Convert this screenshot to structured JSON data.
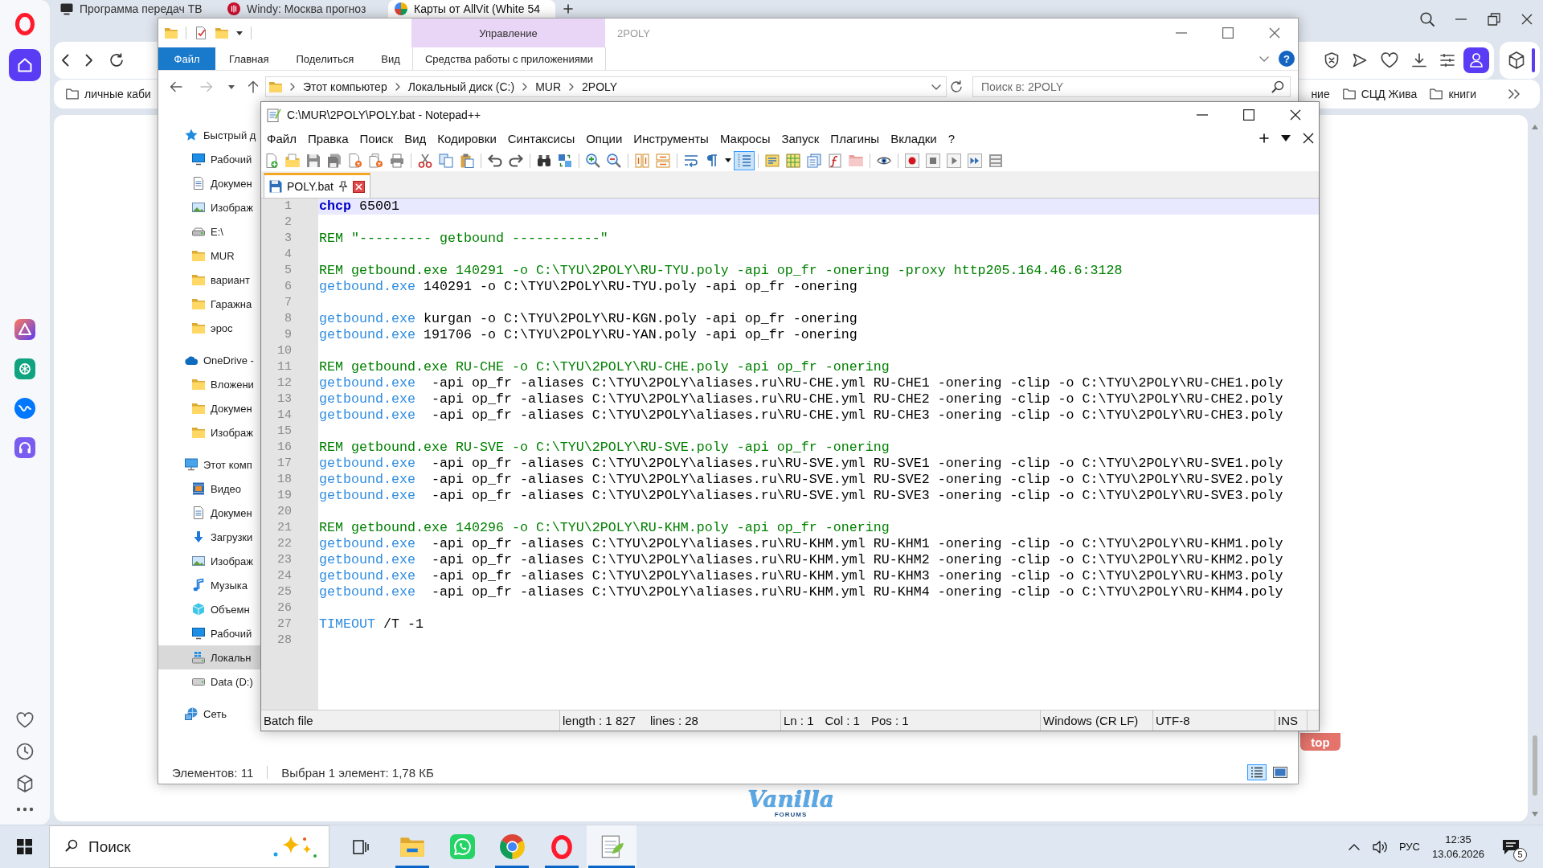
{
  "browser": {
    "tabs": [
      {
        "title": "Программа передач ТВ",
        "kind": "tv",
        "selected": false
      },
      {
        "title": "Windy: Москва прогноз",
        "kind": "weather",
        "selected": false
      },
      {
        "title": "Карты от AllVit (White 54",
        "kind": "maps",
        "selected": true
      }
    ],
    "bookmarks_left": [
      {
        "title": "личные каби",
        "kind": "folder"
      }
    ],
    "bookmarks_right": [
      {
        "title": "ние",
        "kind": "text"
      },
      {
        "title": "СЦД Жива",
        "kind": "folder"
      },
      {
        "title": "книги",
        "kind": "folder"
      }
    ],
    "page": {
      "scroll_top_label": "top",
      "logo": {
        "title": "Vanilla",
        "subtitle": "FORUMS"
      }
    }
  },
  "explorer": {
    "context_group": "Управление",
    "title": "2POLY",
    "ribbon_tabs": [
      {
        "label": "Файл",
        "kind": "file"
      },
      {
        "label": "Главная",
        "kind": "tab"
      },
      {
        "label": "Поделиться",
        "kind": "tab"
      },
      {
        "label": "Вид",
        "kind": "tab"
      },
      {
        "label": "Средства работы с приложениями",
        "kind": "context"
      }
    ],
    "help_label": "?",
    "breadcrumb": [
      "Этот компьютер",
      "Локальный диск (C:)",
      "MUR",
      "2POLY"
    ],
    "search": {
      "placeholder": "Поиск в: 2POLY"
    },
    "navigation": [
      {
        "label": "Быстрый д",
        "kind": "quick-access",
        "selected": false,
        "children": [
          {
            "label": "Рабочий",
            "kind": "desktop",
            "selected": false
          },
          {
            "label": "Докумен",
            "kind": "documents",
            "selected": false
          },
          {
            "label": "Изображ",
            "kind": "pictures",
            "selected": false
          },
          {
            "label": "E:\\",
            "kind": "removable-drive",
            "selected": false
          },
          {
            "label": "MUR",
            "kind": "folder",
            "selected": false
          },
          {
            "label": "вариант",
            "kind": "folder",
            "selected": false
          },
          {
            "label": "Гаражна",
            "kind": "folder",
            "selected": false
          },
          {
            "label": "эрос",
            "kind": "folder",
            "selected": false
          }
        ]
      },
      {
        "label": "OneDrive -",
        "kind": "cloud",
        "selected": false,
        "children": [
          {
            "label": "Вложени",
            "kind": "folder",
            "selected": false
          },
          {
            "label": "Докумен",
            "kind": "folder",
            "selected": false
          },
          {
            "label": "Изображ",
            "kind": "folder",
            "selected": false
          }
        ]
      },
      {
        "label": "Этот комп",
        "kind": "computer",
        "selected": false,
        "children": [
          {
            "label": "Видео",
            "kind": "video",
            "selected": false
          },
          {
            "label": "Докумен",
            "kind": "documents",
            "selected": false
          },
          {
            "label": "Загрузки",
            "kind": "downloads",
            "selected": false
          },
          {
            "label": "Изображ",
            "kind": "pictures",
            "selected": false
          },
          {
            "label": "Музыка",
            "kind": "music",
            "selected": false
          },
          {
            "label": "Объемн",
            "kind": "objects",
            "selected": false
          },
          {
            "label": "Рабочий",
            "kind": "desktop",
            "selected": false
          },
          {
            "label": "Локальн",
            "kind": "local-disk",
            "selected": true
          },
          {
            "label": "Data (D:)",
            "kind": "drive",
            "selected": false
          }
        ]
      },
      {
        "label": "Сеть",
        "kind": "network",
        "selected": false
      }
    ],
    "status": {
      "item_count": "Элементов: 11",
      "selection": "Выбран 1 элемент: 1,78 КБ"
    },
    "views": [
      {
        "kind": "details",
        "selected": true
      },
      {
        "kind": "large-icons",
        "selected": false
      }
    ]
  },
  "notepad": {
    "title": "C:\\MUR\\2POLY\\POLY.bat - Notepad++",
    "menu": [
      "Файл",
      "Правка",
      "Поиск",
      "Вид",
      "Кодировки",
      "Синтаксисы",
      "Опции",
      "Инструменты",
      "Макросы",
      "Запуск",
      "Плагины",
      "Вкладки",
      "?"
    ],
    "view_toggles": [
      {
        "kind": "word-wrap",
        "on": false
      },
      {
        "kind": "show-symbols",
        "on": false
      },
      {
        "kind": "indent-guide",
        "on": true
      }
    ],
    "tabs": [
      {
        "label": "POLY.bat",
        "selected": true
      }
    ],
    "lines": [
      {
        "number": "1",
        "current": true,
        "tokens": [
          {
            "text": "chcp",
            "kind": "keyword"
          },
          {
            "text": " 65001",
            "kind": "plain"
          }
        ]
      },
      {
        "number": "2",
        "current": false
      },
      {
        "number": "3",
        "current": false,
        "tokens": [
          {
            "text": "REM \"--------- getbound -----------\"",
            "kind": "comment"
          }
        ]
      },
      {
        "number": "4",
        "current": false
      },
      {
        "number": "5",
        "current": false,
        "tokens": [
          {
            "text": "REM getbound.exe 140291 -o C:\\TYU\\2POLY\\RU-TYU.poly -api op_fr -onering -proxy http205.164.46.6:3128",
            "kind": "comment"
          }
        ]
      },
      {
        "number": "6",
        "current": false,
        "tokens": [
          {
            "text": "getbound.exe",
            "kind": "command"
          },
          {
            "text": " 140291 -o C:\\TYU\\2POLY\\RU-TYU.poly -api op_fr -onering",
            "kind": "plain"
          }
        ]
      },
      {
        "number": "7",
        "current": false
      },
      {
        "number": "8",
        "current": false,
        "tokens": [
          {
            "text": "getbound.exe",
            "kind": "command"
          },
          {
            "text": " kurgan -o C:\\TYU\\2POLY\\RU-KGN.poly -api op_fr -onering",
            "kind": "plain"
          }
        ]
      },
      {
        "number": "9",
        "current": false,
        "tokens": [
          {
            "text": "getbound.exe",
            "kind": "command"
          },
          {
            "text": " 191706 -o C:\\TYU\\2POLY\\RU-YAN.poly -api op_fr -onering",
            "kind": "plain"
          }
        ]
      },
      {
        "number": "10",
        "current": false
      },
      {
        "number": "11",
        "current": false,
        "tokens": [
          {
            "text": "REM getbound.exe RU-CHE -o C:\\TYU\\2POLY\\RU-CHE.poly -api op_fr -onering",
            "kind": "comment"
          }
        ]
      },
      {
        "number": "12",
        "current": false,
        "tokens": [
          {
            "text": "getbound.exe",
            "kind": "command"
          },
          {
            "text": "  -api op_fr -aliases C:\\TYU\\2POLY\\aliases.ru\\RU-CHE.yml RU-CHE1 -onering -clip -o C:\\TYU\\2POLY\\RU-CHE1.poly",
            "kind": "plain"
          }
        ]
      },
      {
        "number": "13",
        "current": false,
        "tokens": [
          {
            "text": "getbound.exe",
            "kind": "command"
          },
          {
            "text": "  -api op_fr -aliases C:\\TYU\\2POLY\\aliases.ru\\RU-CHE.yml RU-CHE2 -onering -clip -o C:\\TYU\\2POLY\\RU-CHE2.poly",
            "kind": "plain"
          }
        ]
      },
      {
        "number": "14",
        "current": false,
        "tokens": [
          {
            "text": "getbound.exe",
            "kind": "command"
          },
          {
            "text": "  -api op_fr -aliases C:\\TYU\\2POLY\\aliases.ru\\RU-CHE.yml RU-CHE3 -onering -clip -o C:\\TYU\\2POLY\\RU-CHE3.poly",
            "kind": "plain"
          }
        ]
      },
      {
        "number": "15",
        "current": false
      },
      {
        "number": "16",
        "current": false,
        "tokens": [
          {
            "text": "REM getbound.exe RU-SVE -o C:\\TYU\\2POLY\\RU-SVE.poly -api op_fr -onering",
            "kind": "comment"
          }
        ]
      },
      {
        "number": "17",
        "current": false,
        "tokens": [
          {
            "text": "getbound.exe",
            "kind": "command"
          },
          {
            "text": "  -api op_fr -aliases C:\\TYU\\2POLY\\aliases.ru\\RU-SVE.yml RU-SVE1 -onering -clip -o C:\\TYU\\2POLY\\RU-SVE1.poly",
            "kind": "plain"
          }
        ]
      },
      {
        "number": "18",
        "current": false,
        "tokens": [
          {
            "text": "getbound.exe",
            "kind": "command"
          },
          {
            "text": "  -api op_fr -aliases C:\\TYU\\2POLY\\aliases.ru\\RU-SVE.yml RU-SVE2 -onering -clip -o C:\\TYU\\2POLY\\RU-SVE2.poly",
            "kind": "plain"
          }
        ]
      },
      {
        "number": "19",
        "current": false,
        "tokens": [
          {
            "text": "getbound.exe",
            "kind": "command"
          },
          {
            "text": "  -api op_fr -aliases C:\\TYU\\2POLY\\aliases.ru\\RU-SVE.yml RU-SVE3 -onering -clip -o C:\\TYU\\2POLY\\RU-SVE3.poly",
            "kind": "plain"
          }
        ]
      },
      {
        "number": "20",
        "current": false
      },
      {
        "number": "21",
        "current": false,
        "tokens": [
          {
            "text": "REM getbound.exe 140296 -o C:\\TYU\\2POLY\\RU-KHM.poly -api op_fr -onering",
            "kind": "comment"
          }
        ]
      },
      {
        "number": "22",
        "current": false,
        "tokens": [
          {
            "text": "getbound.exe",
            "kind": "command"
          },
          {
            "text": "  -api op_fr -aliases C:\\TYU\\2POLY\\aliases.ru\\RU-KHM.yml RU-KHM1 -onering -clip -o C:\\TYU\\2POLY\\RU-KHM1.poly",
            "kind": "plain"
          }
        ]
      },
      {
        "number": "23",
        "current": false,
        "tokens": [
          {
            "text": "getbound.exe",
            "kind": "command"
          },
          {
            "text": "  -api op_fr -aliases C:\\TYU\\2POLY\\aliases.ru\\RU-KHM.yml RU-KHM2 -onering -clip -o C:\\TYU\\2POLY\\RU-KHM2.poly",
            "kind": "plain"
          }
        ]
      },
      {
        "number": "24",
        "current": false,
        "tokens": [
          {
            "text": "getbound.exe",
            "kind": "command"
          },
          {
            "text": "  -api op_fr -aliases C:\\TYU\\2POLY\\aliases.ru\\RU-KHM.yml RU-KHM3 -onering -clip -o C:\\TYU\\2POLY\\RU-KHM3.poly",
            "kind": "plain"
          }
        ]
      },
      {
        "number": "25",
        "current": false,
        "tokens": [
          {
            "text": "getbound.exe",
            "kind": "command"
          },
          {
            "text": "  -api op_fr -aliases C:\\TYU\\2POLY\\aliases.ru\\RU-KHM.yml RU-KHM4 -onering -clip -o C:\\TYU\\2POLY\\RU-KHM4.poly",
            "kind": "plain"
          }
        ]
      },
      {
        "number": "26",
        "current": false
      },
      {
        "number": "27",
        "current": false,
        "tokens": [
          {
            "text": "TIMEOUT",
            "kind": "command"
          },
          {
            "text": " /T -1",
            "kind": "plain"
          }
        ]
      },
      {
        "number": "28",
        "current": false
      }
    ],
    "status": {
      "file_type": "Batch file",
      "length": "length : 1 827",
      "lines": "lines : 28",
      "line": "Ln : 1",
      "column": "Col : 1",
      "position": "Pos : 1",
      "eol": "Windows (CR LF)",
      "encoding": "UTF-8",
      "mode": "INS"
    }
  },
  "taskbar": {
    "search": {
      "placeholder": "Поиск"
    },
    "apps": [
      {
        "kind": "file-explorer",
        "running": true,
        "selected": false
      },
      {
        "kind": "messenger",
        "running": false,
        "selected": false
      },
      {
        "kind": "chrome",
        "running": true,
        "selected": false
      },
      {
        "kind": "opera",
        "running": true,
        "selected": false
      },
      {
        "kind": "notepad",
        "running": true,
        "selected": true
      }
    ],
    "language": "РУС",
    "time": "12:35",
    "date": "13.06.2026",
    "notification_count": "5"
  }
}
